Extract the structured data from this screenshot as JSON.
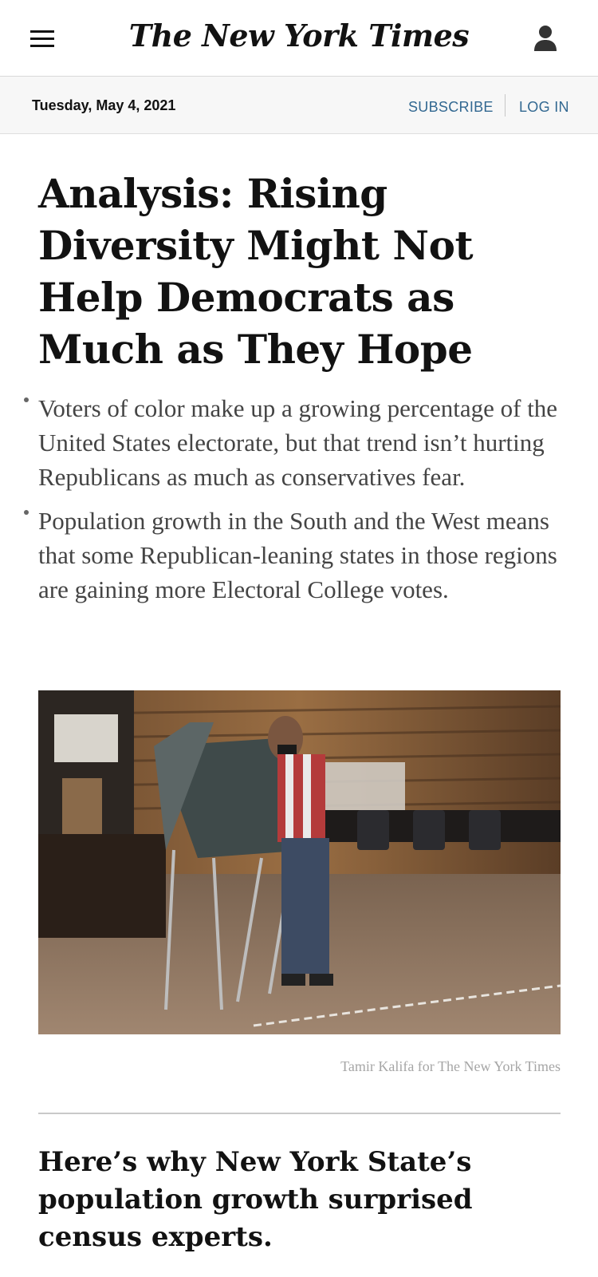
{
  "header": {
    "logo": "The New York Times",
    "menu_icon": "hamburger-menu-icon",
    "account_icon": "user-account-icon"
  },
  "datebar": {
    "date": "Tuesday, May 4, 2021",
    "subscribe_label": "SUBSCRIBE",
    "login_label": "LOG IN"
  },
  "article": {
    "headline": "Analysis: Rising Diversity Might Not Help Democrats as Much as They Hope",
    "bullets": [
      "Voters of color make up a growing percentage of the United States electorate, but that trend isn’t hurting Republicans as much as conservatives fear.",
      "Population growth in the South and the West means that some Republican-leaning states in those regions are gaining more Electoral College votes."
    ],
    "photo_caption": "Tamir Kalifa for The New York Times"
  },
  "next": {
    "headline": "Here’s why New York State’s population growth surprised census experts."
  },
  "colors": {
    "link_blue": "#326891",
    "text_dark": "#121212",
    "bullet_gray": "#444444"
  }
}
